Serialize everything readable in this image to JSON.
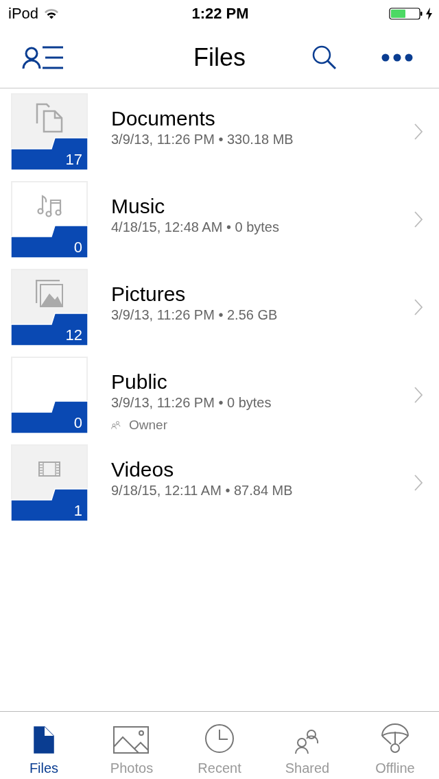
{
  "status_bar": {
    "carrier": "iPod",
    "time": "1:22 PM"
  },
  "nav": {
    "title": "Files"
  },
  "folders": [
    {
      "name": "Documents",
      "details": "3/9/13, 11:26 PM • 330.18 MB",
      "count": "17",
      "kind": "documents"
    },
    {
      "name": "Music",
      "details": "4/18/15, 12:48 AM • 0 bytes",
      "count": "0",
      "kind": "music"
    },
    {
      "name": "Pictures",
      "details": "3/9/13, 11:26 PM • 2.56 GB",
      "count": "12",
      "kind": "pictures"
    },
    {
      "name": "Public",
      "details": "3/9/13, 11:26 PM • 0 bytes",
      "count": "0",
      "kind": "empty",
      "role": "Owner"
    },
    {
      "name": "Videos",
      "details": "9/18/15, 12:11 AM • 87.84 MB",
      "count": "1",
      "kind": "videos"
    }
  ],
  "tabs": [
    {
      "label": "Files",
      "kind": "files",
      "selected": true
    },
    {
      "label": "Photos",
      "kind": "photos",
      "selected": false
    },
    {
      "label": "Recent",
      "kind": "recent",
      "selected": false
    },
    {
      "label": "Shared",
      "kind": "shared",
      "selected": false
    },
    {
      "label": "Offline",
      "kind": "offline",
      "selected": false
    }
  ]
}
